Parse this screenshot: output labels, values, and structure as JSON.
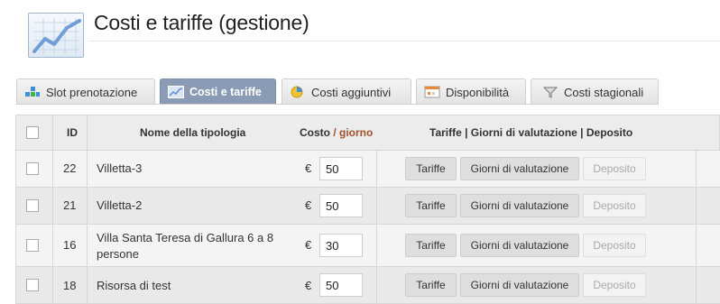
{
  "page": {
    "title": "Costi e tariffe (gestione)"
  },
  "tabs": [
    {
      "label": "Slot prenotazione",
      "icon": "slots-icon"
    },
    {
      "label": "Costi e tariffe",
      "icon": "chart-icon",
      "active": true
    },
    {
      "label": "Costi aggiuntivi",
      "icon": "coin-icon"
    },
    {
      "label": "Disponibilità",
      "icon": "calendar-icon"
    },
    {
      "label": "Costi stagionali",
      "icon": "funnel-icon"
    }
  ],
  "table": {
    "headers": {
      "id": "ID",
      "name": "Nome della tipologia",
      "cost": "Costo",
      "cost_sep": " / ",
      "cost_unit": "giorno",
      "actions": "Tariffe | Giorni di valutazione | Deposito"
    },
    "currency": "€",
    "buttons": {
      "rates": "Tariffe",
      "days": "Giorni di valutazione",
      "deposit": "Deposito"
    },
    "rows": [
      {
        "id": "22",
        "name": "Villetta-3",
        "cost": "50"
      },
      {
        "id": "21",
        "name": "Villetta-2",
        "cost": "50"
      },
      {
        "id": "16",
        "name": "Villa Santa Teresa di Gallura 6 a 8 persone",
        "cost": "30"
      },
      {
        "id": "18",
        "name": "Risorsa di test",
        "cost": "50"
      }
    ]
  },
  "colors": {
    "active_tab": "#8a9bb5",
    "per_day": "#a0522d"
  }
}
